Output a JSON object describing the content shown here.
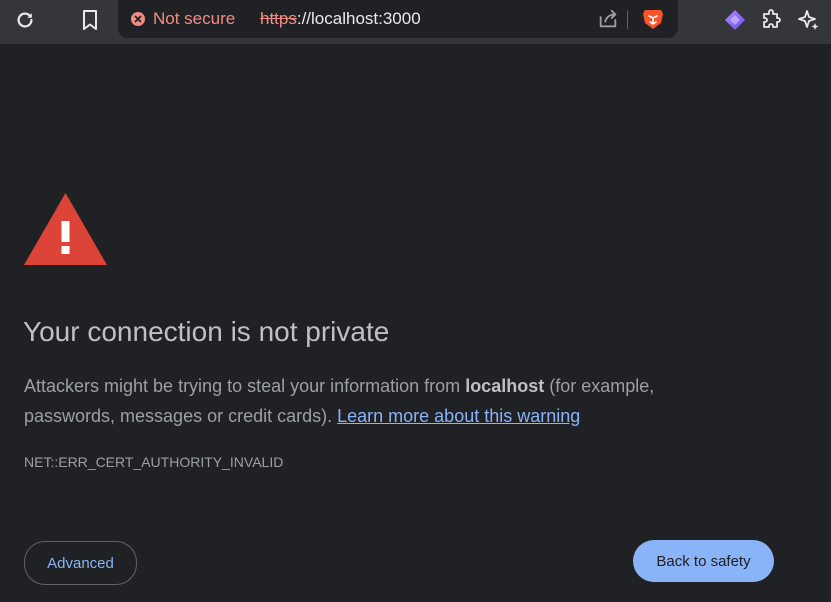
{
  "browser": {
    "icons": {
      "reload": "reload-icon",
      "bookmark": "bookmark-icon",
      "share": "share-icon",
      "brave": "brave-lion-icon",
      "leo": "leo-ai-icon",
      "extensions": "puzzle-icon",
      "sparkle": "sparkle-icon"
    },
    "omnibox": {
      "security_label": "Not secure",
      "url_scheme": "https",
      "url_separator": "://",
      "url_host": "localhost:3000"
    }
  },
  "interstitial": {
    "heading": "Your connection is not private",
    "explanation_prefix": "Attackers might be trying to steal your information from ",
    "host": "localhost",
    "explanation_suffix": " (for example, passwords, messages or credit cards). ",
    "learn_more_link": "Learn more about this warning",
    "error_code": "NET::ERR_CERT_AUTHORITY_INVALID",
    "advanced_button": "Advanced",
    "back_button": "Back to safety"
  },
  "colors": {
    "page_background": "#202124",
    "toolbar_background": "#35363a",
    "warning_red": "#db4437",
    "not_secure_red": "#f28b82",
    "link_blue": "#8ab4f8",
    "primary_button": "#8ab4f8"
  }
}
